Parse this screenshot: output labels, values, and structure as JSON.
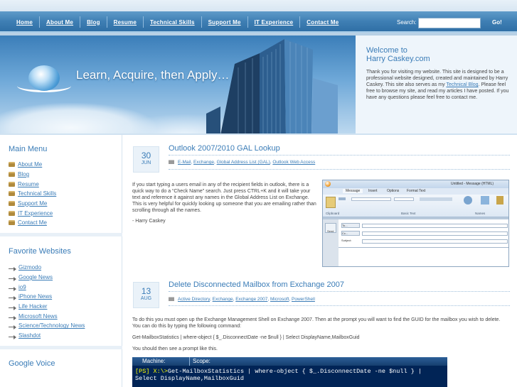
{
  "nav": {
    "items": [
      "Home",
      "About Me",
      "Blog",
      "Resume",
      "Technical Skills",
      "Support Me",
      "IT Experience",
      "Contact Me"
    ],
    "search_label": "Search:",
    "search_value": "",
    "go_label": "Go!"
  },
  "banner": {
    "tagline": "Learn, Acquire, then Apply…"
  },
  "welcome": {
    "title_line1": "Welcome to",
    "title_line2": "Harry Caskey.com",
    "text_before": "Thank you for visiting my website. This site is designed to be a professional website designed, created and maintained by Harry Caskey. This site also serves as my ",
    "link": "Technical Blog",
    "text_after": ". Please feel free to browse my site, and read my articles I have posted. If you have any questions please feel free to contact me."
  },
  "sidebar": {
    "main_menu_title": "Main Menu",
    "main_menu": [
      "About Me",
      "Blog",
      "Resume",
      "Technical Skills",
      "Support Me",
      "IT Experience",
      "Contact Me"
    ],
    "favorites_title": "Favorite Websites",
    "favorites": [
      "Gizmodo",
      "Google News",
      "io9",
      "iPhone News",
      "Life Hacker",
      "Microsoft News",
      "Science/Technology News",
      "Slashdot"
    ],
    "google_voice_title": "Google Voice"
  },
  "posts": [
    {
      "day": "30",
      "month": "JUN",
      "title": "Outlook 2007/2010 GAL Lookup",
      "tags": [
        "E-Mail",
        "Exchange",
        "Global Address List (GAL)",
        "Outlook Web Access"
      ],
      "body": "If you start typing a users email in any of the recipient fields in outlook, there is a quick way to do a “Check Name” search. Just press CTRL+K and it will take your text and reference it against any names in the Global Address List on Exchange. This is very helpful for quickly looking up someone that you are emailing rather than scrolling through all the names.",
      "signature": "- Harry Caskey",
      "screenshot": {
        "title": "Untitled - Message (HTML)",
        "tabs": [
          "Message",
          "Insert",
          "Options",
          "Format Text"
        ],
        "groups": [
          "Clipboard",
          "Basic Text",
          "Names"
        ],
        "fields": [
          "To...",
          "Cc...",
          "Subject:"
        ],
        "send": "Send"
      }
    },
    {
      "day": "13",
      "month": "AUG",
      "title": "Delete Disconnected Mailbox from Exchange 2007",
      "tags": [
        "Active Directory",
        "Exchange",
        "Exchange 2007",
        "Microsoft",
        "PowerShell"
      ],
      "body1": "To do this you must open up the Exchange Management Shell on Exchange 2007.  Then at the prompt you will want to find the GUID for the mailbox you wish to delete.  You can do this by typing the following command:",
      "command": "Get-MailboxStatistics | where-object { $_.DisconnectDate -ne $null } | Select DisplayName,MailboxGuid",
      "body2": "You should then see a prompt like this.",
      "console": {
        "title": "Machine:",
        "scope": "Scope:",
        "prompt": "[PS] X:\\>",
        "line1": "Get-MailboxStatistics | where-object { $_.DisconnectDate -ne $null } |",
        "line2": "Select DisplayName,MailboxGuid"
      }
    }
  ],
  "colors": {
    "accent": "#3a7cb7",
    "nav": "#3f7fb4",
    "console_bg": "#012456"
  }
}
